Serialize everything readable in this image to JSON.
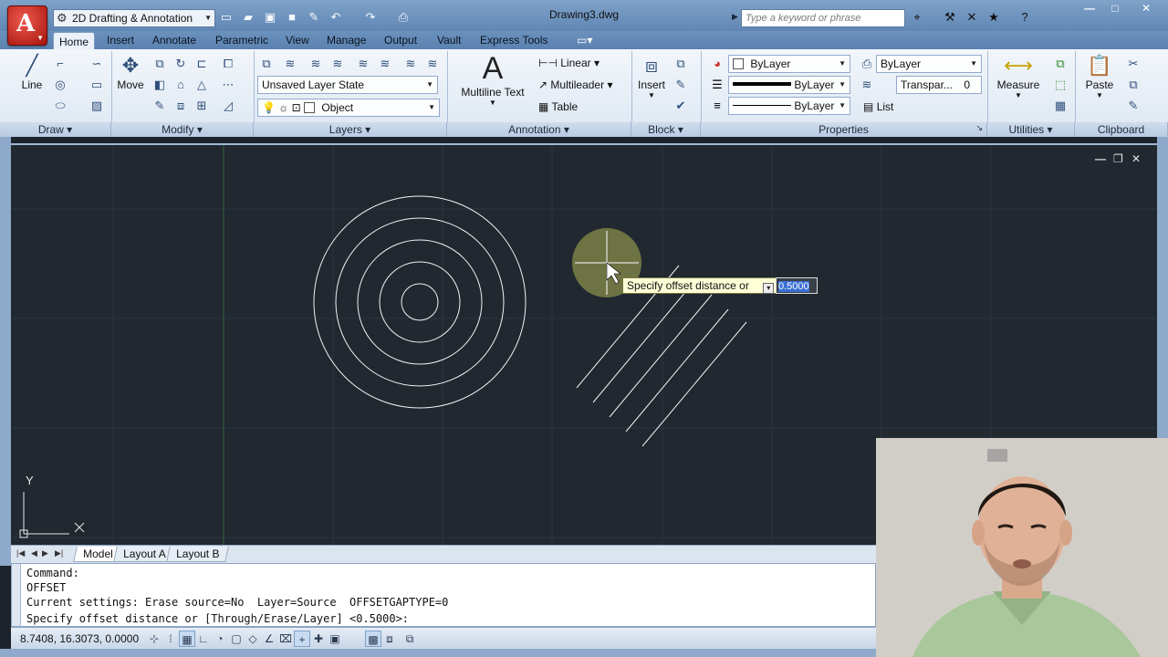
{
  "titlebar": {
    "workspace": "2D Drafting & Annotation",
    "document_title": "Drawing3.dwg",
    "search_placeholder": "Type a keyword or phrase"
  },
  "tabs": [
    "Home",
    "Insert",
    "Annotate",
    "Parametric",
    "View",
    "Manage",
    "Output",
    "Vault",
    "Express Tools"
  ],
  "active_tab": "Home",
  "ribbon": {
    "draw": {
      "title": "Draw",
      "line_label": "Line"
    },
    "modify": {
      "title": "Modify",
      "move_label": "Move"
    },
    "layers": {
      "title": "Layers",
      "layer_state": "Unsaved Layer State",
      "current_layer": "Object"
    },
    "annotation": {
      "title": "Annotation",
      "mtext_label": "Multiline Text",
      "linear": "Linear",
      "multileader": "Multileader",
      "table": "Table"
    },
    "block": {
      "title": "Block",
      "insert_label": "Insert"
    },
    "properties": {
      "title": "Properties",
      "color": "ByLayer",
      "lineweight": "ByLayer",
      "linetype": "ByLayer",
      "plotstyle": "ByLayer",
      "transparency_label": "Transpar...",
      "transparency_value": "0",
      "list": "List"
    },
    "utilities": {
      "title": "Utilities",
      "measure_label": "Measure"
    },
    "clipboard": {
      "title": "Clipboard",
      "paste_label": "Paste"
    }
  },
  "canvas": {
    "tooltip_text": "Specify offset distance or",
    "dynamic_input_value": "0.5000",
    "ucs_y": "Y",
    "ucs_x": "X"
  },
  "layout_tabs": [
    "Model",
    "Layout A",
    "Layout B"
  ],
  "command": {
    "lines": [
      "Command:",
      "OFFSET",
      "Current settings: Erase source=No  Layer=Source  OFFSETGAPTYPE=0",
      "Specify offset distance or [Through/Erase/Layer] <0.5000>:"
    ]
  },
  "status": {
    "coordinates": "8.7408, 16.3073, 0.0000"
  },
  "colors": {
    "canvas_bg": "#212830",
    "ribbon_bg": "#e9f0f8",
    "accent": "#5f86b4",
    "app_button": "#c0231a"
  }
}
